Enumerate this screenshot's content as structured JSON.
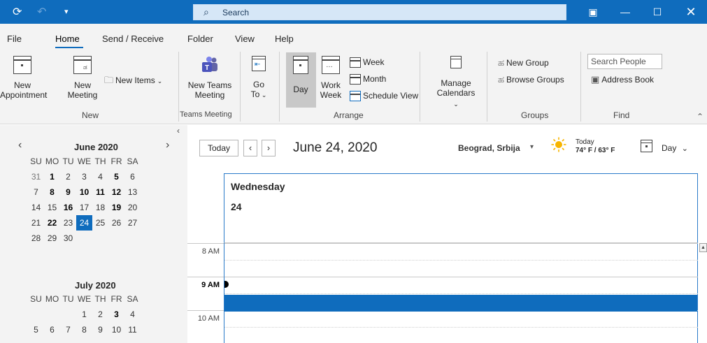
{
  "titlebar": {
    "search_placeholder": "Search",
    "icons": [
      "sync-icon",
      "undo-icon",
      "customize-quick-access-icon",
      "search-icon",
      "coming-soon-icon",
      "minimize-icon",
      "maximize-icon",
      "close-icon"
    ]
  },
  "menu": {
    "tabs": [
      "File",
      "Home",
      "Send / Receive",
      "Folder",
      "View",
      "Help"
    ],
    "active": "Home"
  },
  "ribbon": {
    "new": {
      "new_appointment_1": "New",
      "new_appointment_2": "Appointment",
      "new_meeting_1": "New",
      "new_meeting_2": "Meeting",
      "new_items": "New Items",
      "group": "New"
    },
    "teams": {
      "label_1": "New Teams",
      "label_2": "Meeting",
      "group": "Teams Meeting"
    },
    "goto": {
      "label_1": "Go",
      "label_2": "To"
    },
    "arrange": {
      "day": "Day",
      "work_week_1": "Work",
      "work_week_2": "Week",
      "week": "Week",
      "month": "Month",
      "schedule_view": "Schedule View",
      "group": "Arrange"
    },
    "manage": {
      "label_1": "Manage",
      "label_2": "Calendars"
    },
    "groups": {
      "new_group": "New Group",
      "browse_groups": "Browse Groups",
      "group": "Groups"
    },
    "find": {
      "search_people_placeholder": "Search People",
      "address_book": "Address Book",
      "group": "Find"
    }
  },
  "mini_calendars": [
    {
      "title": "June 2020",
      "weekdays": [
        "SU",
        "MO",
        "TU",
        "WE",
        "TH",
        "FR",
        "SA"
      ],
      "weeks": [
        [
          "31",
          "1",
          "2",
          "3",
          "4",
          "5",
          "6"
        ],
        [
          "7",
          "8",
          "9",
          "10",
          "11",
          "12",
          "13"
        ],
        [
          "14",
          "15",
          "16",
          "17",
          "18",
          "19",
          "20"
        ],
        [
          "21",
          "22",
          "23",
          "24",
          "25",
          "26",
          "27"
        ],
        [
          "28",
          "29",
          "30",
          "",
          "",
          "",
          ""
        ]
      ],
      "bold": [
        "1",
        "5",
        "8",
        "9",
        "10",
        "11",
        "12",
        "16",
        "19",
        "22"
      ],
      "dim": [
        "31"
      ],
      "selected": "24"
    },
    {
      "title": "July 2020",
      "weekdays": [
        "SU",
        "MO",
        "TU",
        "WE",
        "TH",
        "FR",
        "SA"
      ],
      "weeks": [
        [
          "",
          "",
          "",
          "1",
          "2",
          "3",
          "4"
        ],
        [
          "5",
          "6",
          "7",
          "8",
          "9",
          "10",
          "11"
        ]
      ],
      "bold": [
        "3"
      ],
      "dim": [],
      "selected": ""
    }
  ],
  "calendar_view": {
    "today_button": "Today",
    "date_title": "June 24, 2020",
    "location": "Beograd, Srbija",
    "weather_label": "Today",
    "weather_temps": "74° F / 63° F",
    "view_mode": "Day",
    "day_name": "Wednesday",
    "day_number": "24",
    "time_labels": [
      "8 AM",
      "9 AM",
      "10 AM"
    ],
    "current_time_label": "9 AM",
    "colors": {
      "accent": "#0f6cbd",
      "selected_slot": "#0f6cbd",
      "title_bar": "#0f6cbd"
    }
  }
}
